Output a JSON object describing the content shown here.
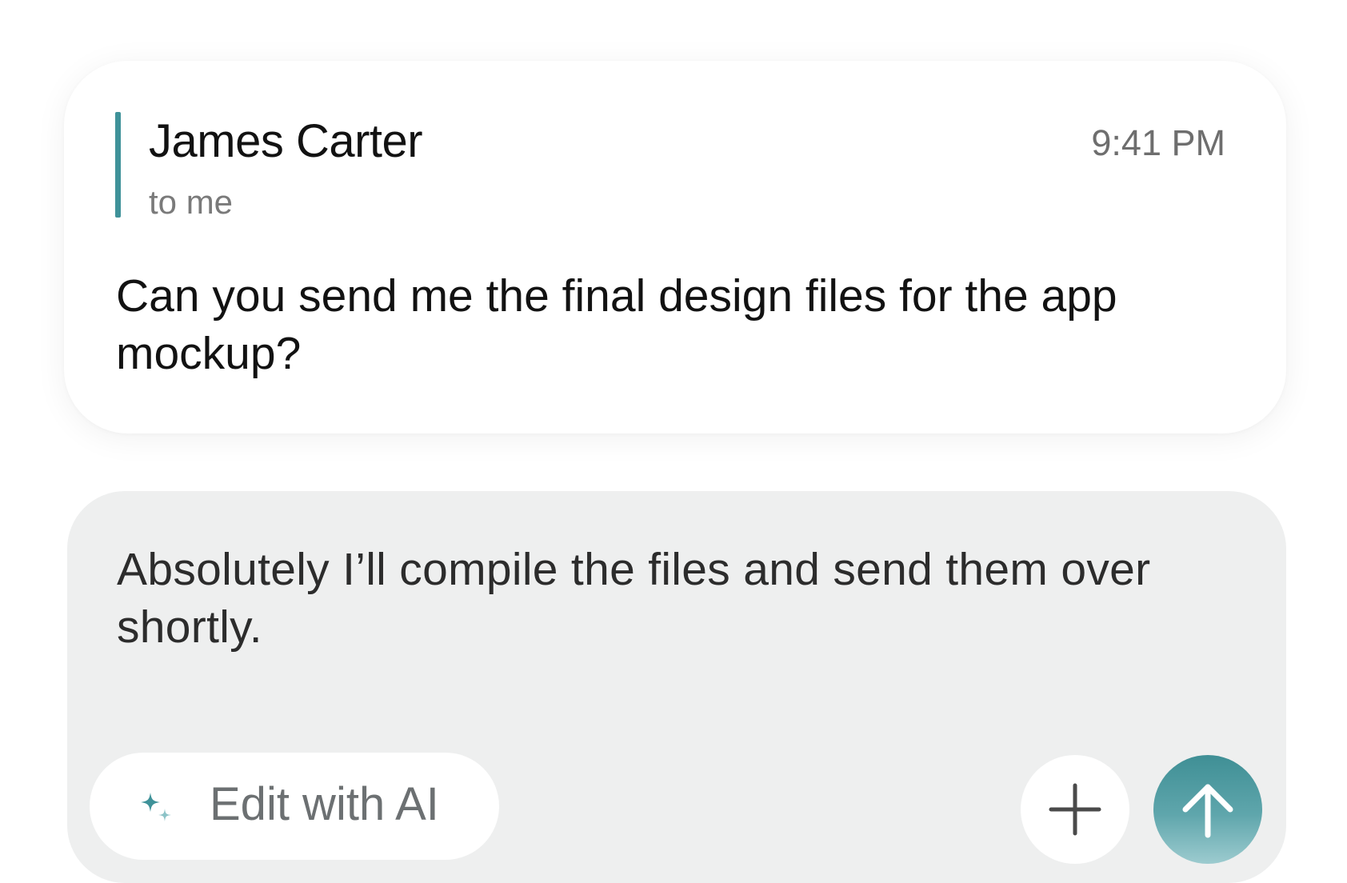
{
  "email": {
    "sender": "James Carter",
    "recipient": "to me",
    "time": "9:41 PM",
    "body": "Can you send me the final design files for the app mockup?"
  },
  "composer": {
    "reply_text": "Absolutely I’ll compile the files and send them over shortly.",
    "ai_button_label": "Edit with AI",
    "ai_icon": "sparkle-icon",
    "attach_icon": "plus-icon",
    "send_icon": "arrow-up-icon"
  },
  "colors": {
    "accent": "#3f9299",
    "composer_bg": "#eeefef",
    "send_gradient_top": "#3f8f95",
    "send_gradient_bottom": "#9ccbcf"
  }
}
